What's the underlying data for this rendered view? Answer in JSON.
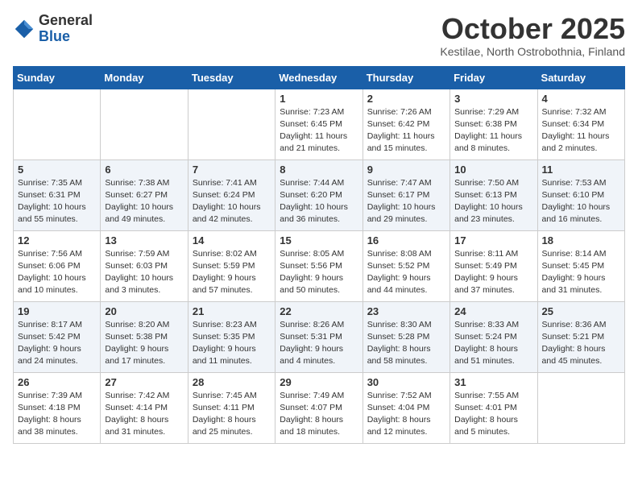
{
  "logo": {
    "general": "General",
    "blue": "Blue"
  },
  "title": "October 2025",
  "subtitle": "Kestilae, North Ostrobothnia, Finland",
  "weekdays": [
    "Sunday",
    "Monday",
    "Tuesday",
    "Wednesday",
    "Thursday",
    "Friday",
    "Saturday"
  ],
  "weeks": [
    [
      {
        "day": "",
        "info": ""
      },
      {
        "day": "",
        "info": ""
      },
      {
        "day": "",
        "info": ""
      },
      {
        "day": "1",
        "info": "Sunrise: 7:23 AM\nSunset: 6:45 PM\nDaylight: 11 hours\nand 21 minutes."
      },
      {
        "day": "2",
        "info": "Sunrise: 7:26 AM\nSunset: 6:42 PM\nDaylight: 11 hours\nand 15 minutes."
      },
      {
        "day": "3",
        "info": "Sunrise: 7:29 AM\nSunset: 6:38 PM\nDaylight: 11 hours\nand 8 minutes."
      },
      {
        "day": "4",
        "info": "Sunrise: 7:32 AM\nSunset: 6:34 PM\nDaylight: 11 hours\nand 2 minutes."
      }
    ],
    [
      {
        "day": "5",
        "info": "Sunrise: 7:35 AM\nSunset: 6:31 PM\nDaylight: 10 hours\nand 55 minutes."
      },
      {
        "day": "6",
        "info": "Sunrise: 7:38 AM\nSunset: 6:27 PM\nDaylight: 10 hours\nand 49 minutes."
      },
      {
        "day": "7",
        "info": "Sunrise: 7:41 AM\nSunset: 6:24 PM\nDaylight: 10 hours\nand 42 minutes."
      },
      {
        "day": "8",
        "info": "Sunrise: 7:44 AM\nSunset: 6:20 PM\nDaylight: 10 hours\nand 36 minutes."
      },
      {
        "day": "9",
        "info": "Sunrise: 7:47 AM\nSunset: 6:17 PM\nDaylight: 10 hours\nand 29 minutes."
      },
      {
        "day": "10",
        "info": "Sunrise: 7:50 AM\nSunset: 6:13 PM\nDaylight: 10 hours\nand 23 minutes."
      },
      {
        "day": "11",
        "info": "Sunrise: 7:53 AM\nSunset: 6:10 PM\nDaylight: 10 hours\nand 16 minutes."
      }
    ],
    [
      {
        "day": "12",
        "info": "Sunrise: 7:56 AM\nSunset: 6:06 PM\nDaylight: 10 hours\nand 10 minutes."
      },
      {
        "day": "13",
        "info": "Sunrise: 7:59 AM\nSunset: 6:03 PM\nDaylight: 10 hours\nand 3 minutes."
      },
      {
        "day": "14",
        "info": "Sunrise: 8:02 AM\nSunset: 5:59 PM\nDaylight: 9 hours\nand 57 minutes."
      },
      {
        "day": "15",
        "info": "Sunrise: 8:05 AM\nSunset: 5:56 PM\nDaylight: 9 hours\nand 50 minutes."
      },
      {
        "day": "16",
        "info": "Sunrise: 8:08 AM\nSunset: 5:52 PM\nDaylight: 9 hours\nand 44 minutes."
      },
      {
        "day": "17",
        "info": "Sunrise: 8:11 AM\nSunset: 5:49 PM\nDaylight: 9 hours\nand 37 minutes."
      },
      {
        "day": "18",
        "info": "Sunrise: 8:14 AM\nSunset: 5:45 PM\nDaylight: 9 hours\nand 31 minutes."
      }
    ],
    [
      {
        "day": "19",
        "info": "Sunrise: 8:17 AM\nSunset: 5:42 PM\nDaylight: 9 hours\nand 24 minutes."
      },
      {
        "day": "20",
        "info": "Sunrise: 8:20 AM\nSunset: 5:38 PM\nDaylight: 9 hours\nand 17 minutes."
      },
      {
        "day": "21",
        "info": "Sunrise: 8:23 AM\nSunset: 5:35 PM\nDaylight: 9 hours\nand 11 minutes."
      },
      {
        "day": "22",
        "info": "Sunrise: 8:26 AM\nSunset: 5:31 PM\nDaylight: 9 hours\nand 4 minutes."
      },
      {
        "day": "23",
        "info": "Sunrise: 8:30 AM\nSunset: 5:28 PM\nDaylight: 8 hours\nand 58 minutes."
      },
      {
        "day": "24",
        "info": "Sunrise: 8:33 AM\nSunset: 5:24 PM\nDaylight: 8 hours\nand 51 minutes."
      },
      {
        "day": "25",
        "info": "Sunrise: 8:36 AM\nSunset: 5:21 PM\nDaylight: 8 hours\nand 45 minutes."
      }
    ],
    [
      {
        "day": "26",
        "info": "Sunrise: 7:39 AM\nSunset: 4:18 PM\nDaylight: 8 hours\nand 38 minutes."
      },
      {
        "day": "27",
        "info": "Sunrise: 7:42 AM\nSunset: 4:14 PM\nDaylight: 8 hours\nand 31 minutes."
      },
      {
        "day": "28",
        "info": "Sunrise: 7:45 AM\nSunset: 4:11 PM\nDaylight: 8 hours\nand 25 minutes."
      },
      {
        "day": "29",
        "info": "Sunrise: 7:49 AM\nSunset: 4:07 PM\nDaylight: 8 hours\nand 18 minutes."
      },
      {
        "day": "30",
        "info": "Sunrise: 7:52 AM\nSunset: 4:04 PM\nDaylight: 8 hours\nand 12 minutes."
      },
      {
        "day": "31",
        "info": "Sunrise: 7:55 AM\nSunset: 4:01 PM\nDaylight: 8 hours\nand 5 minutes."
      },
      {
        "day": "",
        "info": ""
      }
    ]
  ]
}
